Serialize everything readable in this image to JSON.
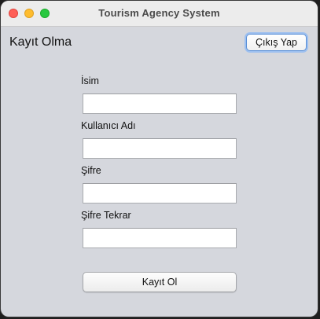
{
  "window": {
    "title": "Tourism Agency System"
  },
  "header": {
    "heading": "Kayıt Olma",
    "exit_button_label": "Çıkış Yap"
  },
  "form": {
    "fields": [
      {
        "label": "İsim",
        "value": ""
      },
      {
        "label": "Kullanıcı Adı",
        "value": ""
      },
      {
        "label": "Şifre",
        "value": ""
      },
      {
        "label": "Şifre Tekrar",
        "value": ""
      }
    ],
    "submit_label": "Kayıt Ol"
  },
  "colors": {
    "window_bg": "#d5d7dd",
    "titlebar_bg": "#ececec",
    "focus_ring": "#5a8fd6",
    "close": "#fe5f57",
    "minimize": "#febc2e",
    "zoom": "#28c840"
  }
}
